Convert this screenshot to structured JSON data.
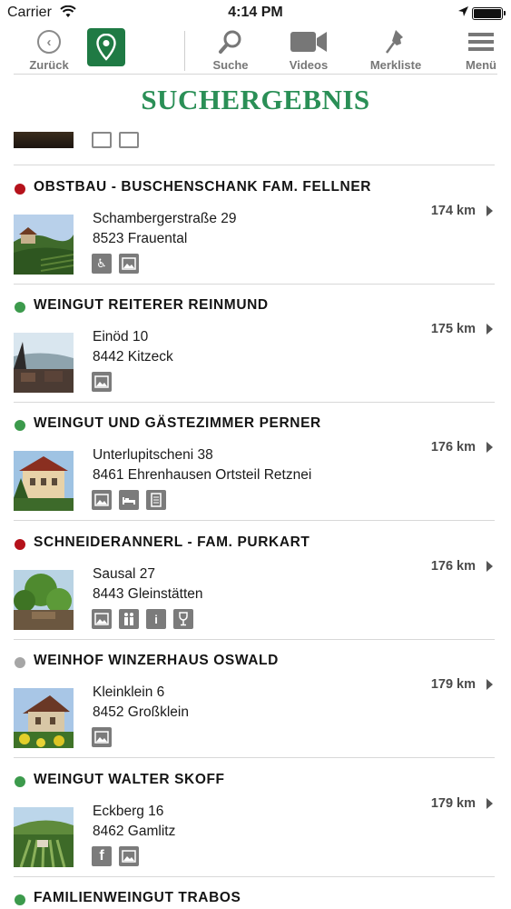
{
  "status": {
    "carrier": "Carrier",
    "time": "4:14 PM"
  },
  "toolbar": {
    "back_label": "Zurück",
    "search_label": "Suche",
    "videos_label": "Videos",
    "bookmarks_label": "Merkliste",
    "menu_label": "Menü"
  },
  "page": {
    "title": "SUCHERGEBNIS"
  },
  "colors": {
    "brand_green": "#1f7a44",
    "title_green": "#2a8f56",
    "dot_red": "#b5121b",
    "dot_green": "#3c9a4c",
    "dot_grey": "#a6a6a6"
  },
  "results": [
    {
      "name": "OBSTBAU - BUSCHENSCHANK FAM. FELLNER",
      "street": "Schambergerstraße 29",
      "city": "8523 Frauental",
      "distance": "174 km",
      "status": "red",
      "icons": [
        "wheelchair-icon",
        "gallery-icon"
      ]
    },
    {
      "name": "WEINGUT REITERER REINMUND",
      "street": "Einöd 10",
      "city": "8442 Kitzeck",
      "distance": "175 km",
      "status": "green",
      "icons": [
        "gallery-icon"
      ]
    },
    {
      "name": "WEINGUT UND GÄSTEZIMMER PERNER",
      "street": "Unterlupitscheni 38",
      "city": "8461 Ehrenhausen Ortsteil Retznei",
      "distance": "176 km",
      "status": "green",
      "icons": [
        "gallery-icon",
        "bed-icon",
        "document-icon"
      ]
    },
    {
      "name": "SCHNEIDERANNERL - FAM. PURKART",
      "street": "Sausal 27",
      "city": "8443 Gleinstätten",
      "distance": "176 km",
      "status": "red",
      "icons": [
        "gallery-icon",
        "family-icon",
        "info-icon",
        "wine-glass-icon"
      ]
    },
    {
      "name": "WEINHOF WINZERHAUS OSWALD",
      "street": "Kleinklein 6",
      "city": "8452 Großklein",
      "distance": "179 km",
      "status": "grey",
      "icons": [
        "gallery-icon"
      ]
    },
    {
      "name": "WEINGUT WALTER SKOFF",
      "street": "Eckberg 16",
      "city": "8462 Gamlitz",
      "distance": "179 km",
      "status": "green",
      "icons": [
        "facebook-icon",
        "gallery-icon"
      ]
    },
    {
      "name": "FAMILIENWEINGUT TRABOS",
      "status": "green"
    }
  ]
}
